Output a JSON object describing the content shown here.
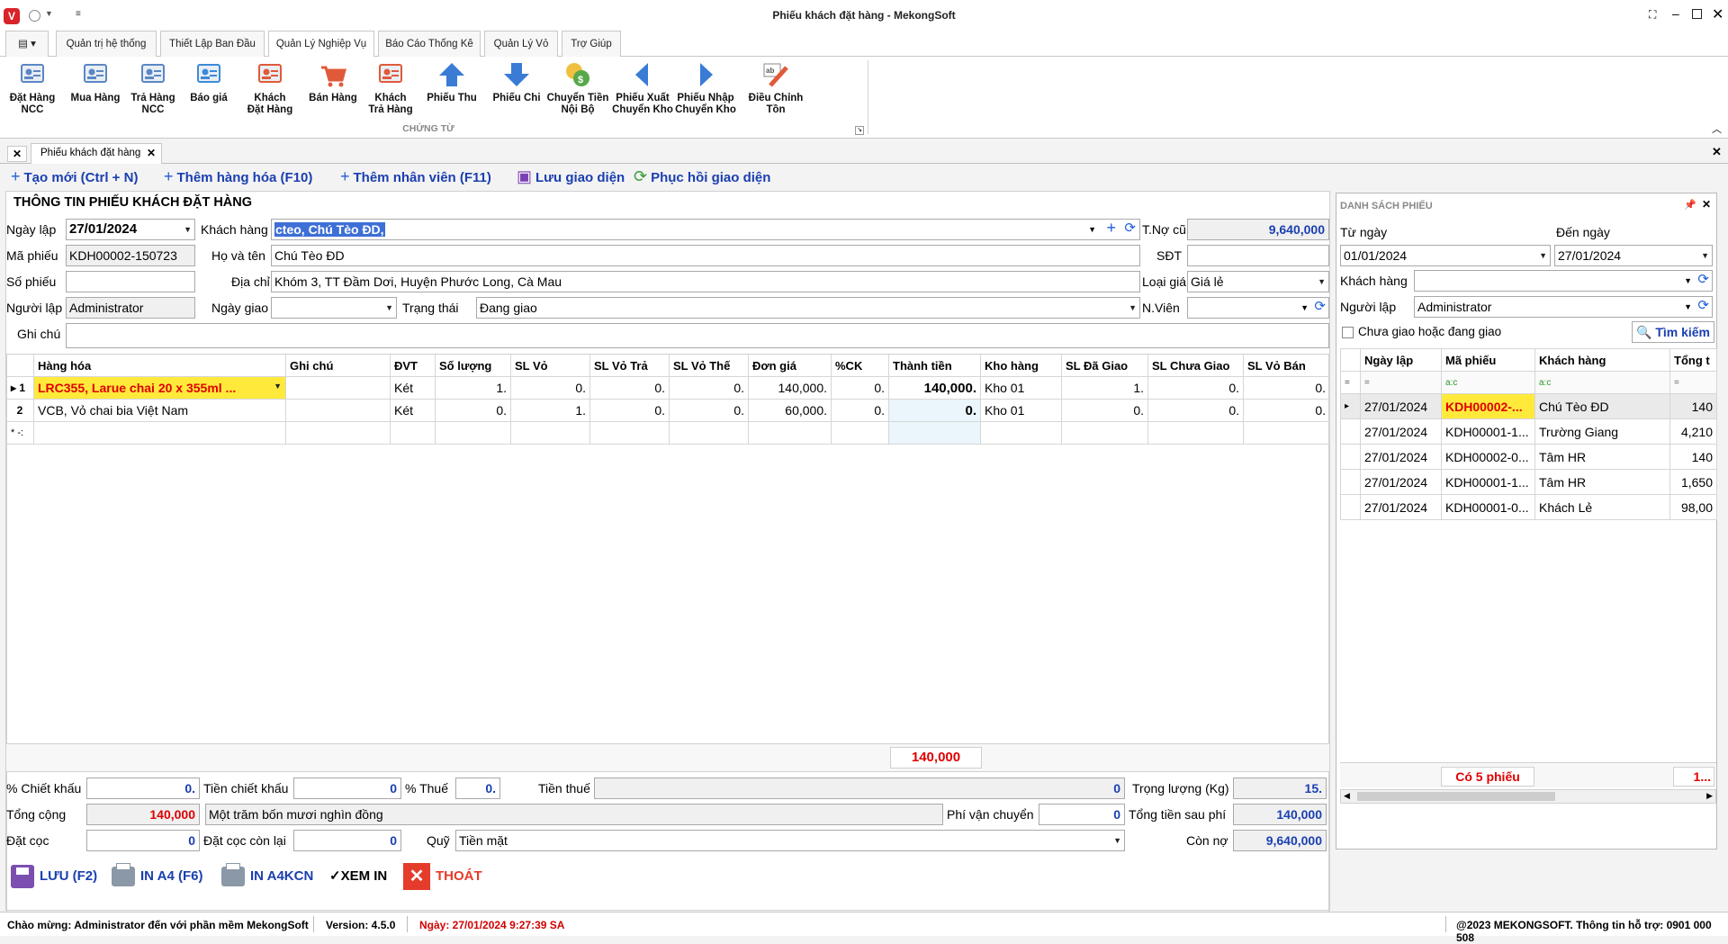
{
  "window": {
    "title": "Phiếu khách đặt hàng - MekongSoft"
  },
  "ribbon_tabs": [
    "Quản trị hệ thống",
    "Thiết Lập Ban Đầu",
    "Quản Lý Nghiệp Vụ",
    "Báo Cáo Thống Kê",
    "Quản Lý Vỏ",
    "Trợ Giúp"
  ],
  "ribbon_group": "CHỨNG TỪ",
  "ribbon_buttons": [
    {
      "l1": "Đặt Hàng",
      "l2": "NCC",
      "icon": "vendor-order-icon"
    },
    {
      "l1": "Mua Hàng",
      "l2": "",
      "icon": "purchase-icon"
    },
    {
      "l1": "Trả Hàng",
      "l2": "NCC",
      "icon": "vendor-return-icon"
    },
    {
      "l1": "Báo giá",
      "l2": "",
      "icon": "quote-icon"
    },
    {
      "l1": "Khách",
      "l2": "Đặt Hàng",
      "icon": "customer-order-icon"
    },
    {
      "l1": "Bán Hàng",
      "l2": "",
      "icon": "sales-cart-icon"
    },
    {
      "l1": "Khách",
      "l2": "Trả Hàng",
      "icon": "customer-return-icon"
    },
    {
      "l1": "Phiếu Thu",
      "l2": "",
      "icon": "receipt-up-arrow-icon"
    },
    {
      "l1": "Phiếu Chi",
      "l2": "",
      "icon": "payment-down-arrow-icon"
    },
    {
      "l1": "Chuyển Tiền",
      "l2": "Nội Bộ",
      "icon": "money-transfer-icon"
    },
    {
      "l1": "Phiếu Xuất",
      "l2": "Chuyển Kho",
      "icon": "export-left-arrow-icon"
    },
    {
      "l1": "Phiếu Nhập",
      "l2": "Chuyển Kho",
      "icon": "import-right-arrow-icon"
    },
    {
      "l1": "Điều Chỉnh Tồn",
      "l2": "",
      "icon": "stock-adjust-icon"
    }
  ],
  "doc_tab": "Phiếu khách đặt hàng",
  "toolbar": {
    "new": "Tạo mới (Ctrl + N)",
    "add_item": "Thêm hàng hóa (F10)",
    "add_staff": "Thêm nhân viên (F11)",
    "save_layout": "Lưu giao diện",
    "restore_layout": "Phục hồi giao diện"
  },
  "form": {
    "heading": "THÔNG TIN PHIẾU KHÁCH ĐẶT HÀNG",
    "date_label": "Ngày lập",
    "date_value": "27/01/2024",
    "customer_label": "Khách hàng",
    "customer_value": "cteo, Chú Tèo ĐD,",
    "old_debt_label": "T.Nợ cũ",
    "old_debt_value": "9,640,000",
    "code_label": "Mã phiếu",
    "code_value": "KDH00002-150723",
    "name_label": "Họ và tên",
    "name_value": "Chú Tèo ĐD",
    "phone_label": "SĐT",
    "phone_value": "",
    "docno_label": "Số phiếu",
    "docno_value": "",
    "address_label": "Địa chỉ",
    "address_value": "Khóm 3, TT Đầm Dơi, Huyện Phước Long, Cà Mau",
    "price_type_label": "Loại giá",
    "price_type_value": "Giá lẻ",
    "creator_label": "Người lập",
    "creator_value": "Administrator",
    "delivery_label": "Ngày giao",
    "delivery_value": "",
    "status_label": "Trạng thái",
    "status_value": "Đang giao",
    "staff_label": "N.Viên",
    "staff_value": "",
    "note_label": "Ghi chú",
    "note_value": ""
  },
  "grid": {
    "headers": [
      "Hàng hóa",
      "Ghi chú",
      "ĐVT",
      "Số lượng",
      "SL Vỏ",
      "SL Vỏ Trả",
      "SL Vỏ Thế",
      "Đơn giá",
      "%CK",
      "Thành tiền",
      "Kho hàng",
      "SL Đã Giao",
      "SL Chưa Giao",
      "SL Vỏ Bán"
    ],
    "rows": [
      {
        "no": "1",
        "item": "LRC355, Larue chai 20 x 355ml ...",
        "note": "",
        "unit": "Két",
        "qty": "1.",
        "shell": "0.",
        "shell_ret": "0.",
        "shell_dep": "0.",
        "price": "140,000.",
        "disc": "0.",
        "amount": "140,000.",
        "wh": "Kho 01",
        "delivered": "1.",
        "pending": "0.",
        "shell_sold": "0."
      },
      {
        "no": "2",
        "item": "VCB, Vỏ chai bia Việt Nam",
        "note": "",
        "unit": "Két",
        "qty": "0.",
        "shell": "1.",
        "shell_ret": "0.",
        "shell_dep": "0.",
        "price": "60,000.",
        "disc": "0.",
        "amount": "0.",
        "wh": "Kho 01",
        "delivered": "0.",
        "pending": "0.",
        "shell_sold": "0."
      }
    ],
    "new_row_marker": "* -:",
    "total": "140,000"
  },
  "summary": {
    "disc_pct_label": "% Chiết khấu",
    "disc_pct_value": "0.",
    "disc_amt_label": "Tiền chiết khấu",
    "disc_amt_value": "0",
    "tax_pct_label": "% Thuế",
    "tax_pct_value": "0.",
    "tax_amt_label": "Tiền thuế",
    "tax_amt_value": "0",
    "weight_label": "Trọng lượng (Kg)",
    "weight_value": "15.",
    "total_label": "Tổng cộng",
    "total_value": "140,000",
    "total_words": "Một trăm bốn mươi nghìn đồng",
    "shipping_label": "Phí vận chuyển",
    "shipping_value": "0",
    "after_fee_label": "Tổng tiền sau phí",
    "after_fee_value": "140,000",
    "deposit_label": "Đặt cọc",
    "deposit_value": "0",
    "deposit_rem_label": "Đặt cọc còn lại",
    "deposit_rem_value": "0",
    "fund_label": "Quỹ",
    "fund_value": "Tiền mặt",
    "remaining_label": "Còn nợ",
    "remaining_value": "9,640,000"
  },
  "actions": {
    "save": "LƯU (F2)",
    "print_a4": "IN A4 (F6)",
    "print_a4kcn": "IN A4KCN",
    "preview": "XEM IN",
    "exit": "THOÁT"
  },
  "side": {
    "title": "DANH SÁCH PHIẾU",
    "from_label": "Từ ngày",
    "from_value": "01/01/2024",
    "to_label": "Đến ngày",
    "to_value": "27/01/2024",
    "customer_label": "Khách hàng",
    "customer_value": "",
    "creator_label": "Người lập",
    "creator_value": "Administrator",
    "pending_label": "Chưa giao hoặc đang giao",
    "search": "Tìm kiếm",
    "headers": [
      "Ngày lập",
      "Mã phiếu",
      "Khách hàng",
      "Tổng t"
    ],
    "filter_ops": [
      "=",
      "=",
      "a:c",
      "a:c",
      "="
    ],
    "rows": [
      {
        "date": "27/01/2024",
        "code": "KDH00002-...",
        "customer": "Chú Tèo ĐD",
        "total": "140"
      },
      {
        "date": "27/01/2024",
        "code": "KDH00001-1...",
        "customer": "Trường Giang",
        "total": "4,210"
      },
      {
        "date": "27/01/2024",
        "code": "KDH00002-0...",
        "customer": "Tâm HR",
        "total": "140"
      },
      {
        "date": "27/01/2024",
        "code": "KDH00001-1...",
        "customer": "Tâm HR",
        "total": "1,650"
      },
      {
        "date": "27/01/2024",
        "code": "KDH00001-0...",
        "customer": "Khách Lẻ",
        "total": "98,00"
      }
    ],
    "count": "Có 5 phiếu",
    "sum": "1..."
  },
  "status": {
    "welcome": "Chào mừng: Administrator đến với phần mềm MekongSoft",
    "version": "Version: 4.5.0",
    "datetime": "Ngày: 27/01/2024 9:27:39 SA",
    "copyright": "@2023 MEKONGSOFT. Thông tin hỗ trợ: 0901 000 508"
  }
}
